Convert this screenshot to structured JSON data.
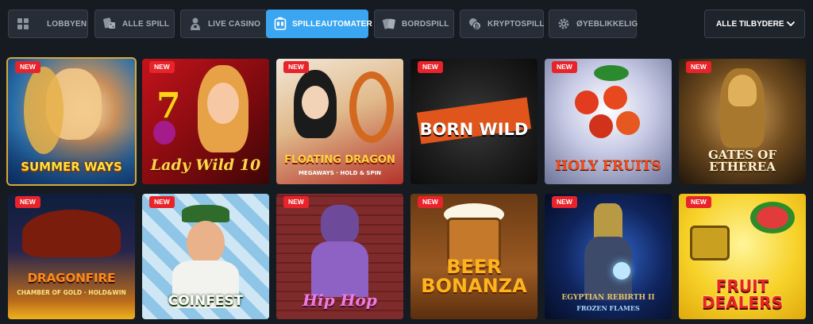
{
  "nav": {
    "tabs": [
      {
        "label": "LOBBYEN",
        "icon": "grid-icon",
        "active": false
      },
      {
        "label": "ALLE SPILL",
        "icon": "cards-dice-icon",
        "active": false
      },
      {
        "label": "LIVE CASINO",
        "icon": "live-dealer-icon",
        "active": false
      },
      {
        "label": "SPILLEAUTOMATER",
        "icon": "slot-machine-icon",
        "active": true
      },
      {
        "label": "BORDSPILL",
        "icon": "playing-cards-icon",
        "active": false
      },
      {
        "label": "KRYPTOSPILL",
        "icon": "crypto-coin-icon",
        "active": false
      },
      {
        "label": "ØYEBLIKKELIG",
        "icon": "gear-icon",
        "active": false
      }
    ],
    "provider_select": {
      "label": "ALLE TILBYDERE",
      "icon": "chevron-down-icon"
    }
  },
  "games": [
    {
      "title": "SUMMER WAYS",
      "badge": "NEW",
      "selected": true
    },
    {
      "title": "Lady Wild 10",
      "badge": "NEW"
    },
    {
      "title": "FLOATING DRAGON",
      "subtitle": "MEGAWAYS · HOLD & SPIN",
      "badge": "NEW"
    },
    {
      "title": "BORN WILD",
      "badge": "NEW"
    },
    {
      "title": "HOLY FRUITS",
      "badge": "NEW"
    },
    {
      "title": "GATES OF ETHEREA",
      "badge": "NEW"
    },
    {
      "title": "DRAGONFIRE",
      "subtitle": "CHAMBER OF GOLD · HOLD&WIN",
      "badge": "NEW"
    },
    {
      "title": "COINFEST",
      "badge": "NEW"
    },
    {
      "title": "Hip Hop",
      "badge": "NEW"
    },
    {
      "title": "BEER BONANZA",
      "badge": "NEW"
    },
    {
      "title": "EGYPTIAN REBIRTH II",
      "subtitle": "FROZEN FLAMES",
      "badge": "NEW"
    },
    {
      "title": "FRUIT DEALERS",
      "badge": "NEW"
    }
  ],
  "colors": {
    "background": "#161b22",
    "tab_bg": "#262d36",
    "tab_active": "#3aa5f0",
    "badge_red": "#e8232a",
    "selected_outline": "#d7a73a"
  }
}
